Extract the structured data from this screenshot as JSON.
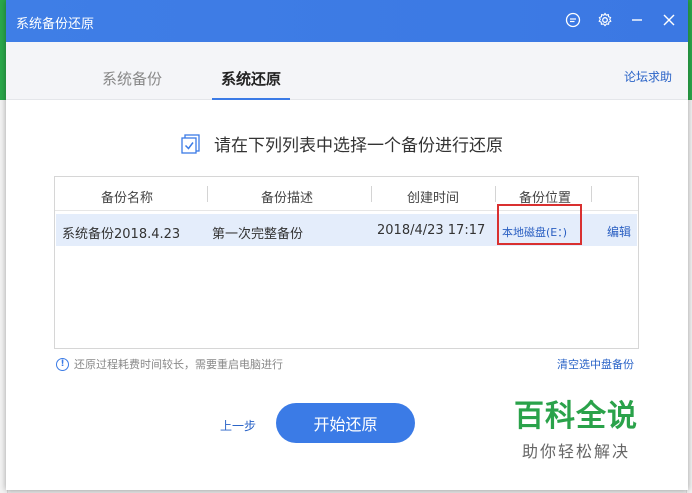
{
  "window": {
    "title": "系统备份还原"
  },
  "titlebar_icons": [
    "feedback-icon",
    "settings-icon",
    "minimize-icon",
    "close-icon"
  ],
  "tabs": [
    {
      "label": "系统备份",
      "active": false
    },
    {
      "label": "系统还原",
      "active": true
    }
  ],
  "forum_link": "论坛求助",
  "instruction": "请在下列列表中选择一个备份进行还原",
  "table": {
    "headers": [
      "备份名称",
      "备份描述",
      "创建时间",
      "备份位置"
    ],
    "rows": [
      {
        "name": "系统备份2018.4.23",
        "description": "第一次完整备份",
        "created": "2018/4/23 17:17",
        "location": "本地磁盘(E：)",
        "action": "编辑"
      }
    ]
  },
  "hint": "还原过程耗费时间较长，需要重启电脑进行",
  "clear_link": "清空选中盘备份",
  "prev_step": "上一步",
  "start_button": "开始还原",
  "watermark": {
    "main": "百科全说",
    "sub": "助你轻松解决"
  },
  "colors": {
    "accent": "#3b7be6",
    "highlight_border": "#d93030",
    "watermark_green": "#2aa24a",
    "row_selected": "#e4edfb"
  }
}
